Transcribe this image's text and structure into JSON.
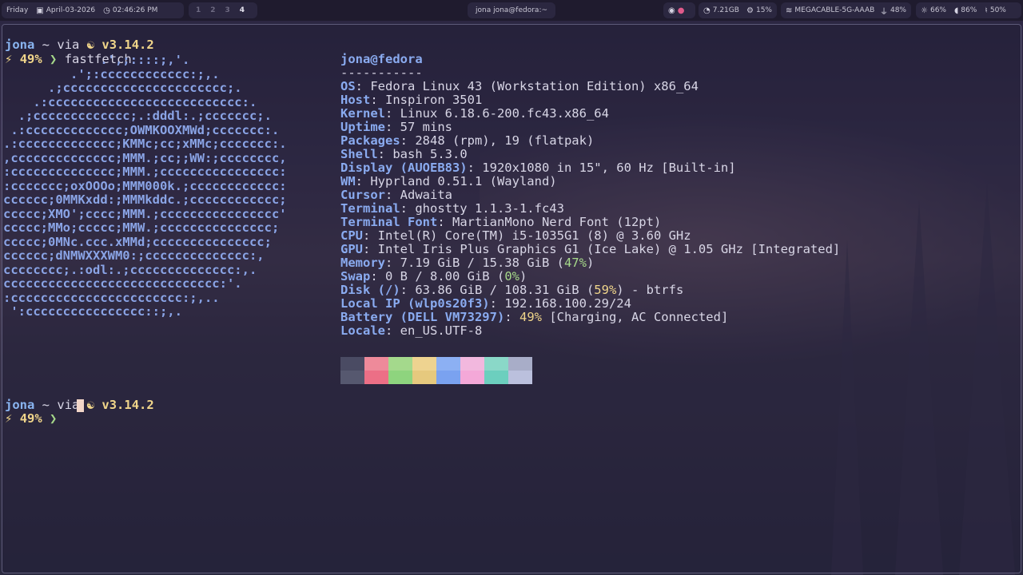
{
  "topbar": {
    "day": "Friday",
    "date": "April-03-2026",
    "time": "02:46:26 PM",
    "workspaces": [
      "1",
      "2",
      "3",
      "4"
    ],
    "active_workspace": "4",
    "window_title": "jona jona@fedora:~",
    "memory": "7.21GB",
    "cpu": "15%",
    "wifi": "MEGACABLE-5G-AAAB",
    "battery": "48%",
    "brightness": "66%",
    "volume": "86%",
    "mic": "50%"
  },
  "prompt1": {
    "user": "jona",
    "dir": "~",
    "via": "via",
    "python": "v3.14.2",
    "battery": "49%",
    "arrow": "❯",
    "command": "fastfetch"
  },
  "ascii_logo": [
    "             .',;::::;,'.",
    "         .';:cccccccccccc:;,.",
    "      .;cccccccccccccccccccccc;.",
    "    .:cccccccccccccccccccccccccc:.",
    "  .;ccccccccccccc;.:dddl:.;ccccccc;.",
    " .:ccccccccccccc;OWMKOOXMWd;ccccccc:.",
    ".:ccccccccccccc;KMMc;cc;xMMc;ccccccc:.",
    ",cccccccccccccc;MMM.;cc;;WW:;cccccccc,",
    ":cccccccccccccc;MMM.;cccccccccccccccc:",
    ":ccccccc;oxOOOo;MMM000k.;cccccccccccc:",
    "cccccc;0MMKxdd:;MMMkddc.;cccccccccccc;",
    "ccccc;XMO';cccc;MMM.;cccccccccccccccc'",
    "ccccc;MMo;ccccc;MMW.;ccccccccccccccc;",
    "ccccc;0MNc.ccc.xMMd;ccccccccccccccc;",
    "cccccc;dNMWXXXWM0:;cccccccccccccc:,",
    "cccccccc;.:odl:.;cccccccccccccc:,.",
    "ccccccccccccccccccccccccccccc:'.",
    ":ccccccccccccccccccccccc:;,..",
    " ':cccccccccccccccc::;,."
  ],
  "sysinfo": {
    "title": "jona@fedora",
    "rule": "-----------",
    "rows": [
      {
        "key": "OS",
        "value": ": Fedora Linux 43 (Workstation Edition) x86_64"
      },
      {
        "key": "Host",
        "value": ": Inspiron 3501"
      },
      {
        "key": "Kernel",
        "value": ": Linux 6.18.6-200.fc43.x86_64"
      },
      {
        "key": "Uptime",
        "value": ": 57 mins"
      },
      {
        "key": "Packages",
        "value": ": 2848 (rpm), 19 (flatpak)"
      },
      {
        "key": "Shell",
        "value": ": bash 5.3.0"
      },
      {
        "key": "Display (AUOEB83)",
        "value": ": 1920x1080 in 15\", 60 Hz [Built-in]"
      },
      {
        "key": "WM",
        "value": ": Hyprland 0.51.1 (Wayland)"
      },
      {
        "key": "Cursor",
        "value": ": Adwaita"
      },
      {
        "key": "Terminal",
        "value": ": ghostty 1.1.3-1.fc43"
      },
      {
        "key": "Terminal Font",
        "value": ": MartianMono Nerd Font (12pt)"
      },
      {
        "key": "CPU",
        "value": ": Intel(R) Core(TM) i5-1035G1 (8) @ 3.60 GHz"
      },
      {
        "key": "GPU",
        "value": ": Intel Iris Plus Graphics G1 (Ice Lake) @ 1.05 GHz [Integrated]"
      },
      {
        "key": "Memory",
        "value_a": ": 7.19 GiB / 15.38 GiB (",
        "pct": "47%",
        "value_b": ")"
      },
      {
        "key": "Swap",
        "value_a": ": 0 B / 8.00 GiB (",
        "pct": "0%",
        "value_b": ")"
      },
      {
        "key": "Disk (/)",
        "value_a": ": 63.86 GiB / 108.31 GiB (",
        "pct": "59%",
        "value_b": ") - btrfs"
      },
      {
        "key": "Local IP (wlp0s20f3)",
        "value": ": 192.168.100.29/24"
      },
      {
        "key": "Battery (DELL VM73297)",
        "value_a": ": ",
        "pct": "49%",
        "value_b": " [Charging, AC Connected]"
      },
      {
        "key": "Locale",
        "value": ": en_US.UTF-8"
      }
    ]
  },
  "palette": {
    "top": [
      "#4a4b63",
      "#ee8a9a",
      "#a4d98c",
      "#eed390",
      "#8cb0f3",
      "#f2b8de",
      "#8ad8c8",
      "#a8adc8"
    ],
    "bottom": [
      "#56586f",
      "#ec6f86",
      "#8ed47e",
      "#e6c97e",
      "#7aa2f0",
      "#f4a8d8",
      "#6ccfbe",
      "#bbc0dd"
    ]
  },
  "prompt2": {
    "user": "jona",
    "dir": "~",
    "via": "via",
    "python": "v3.14.2",
    "battery": "49%",
    "arrow": "❯"
  }
}
